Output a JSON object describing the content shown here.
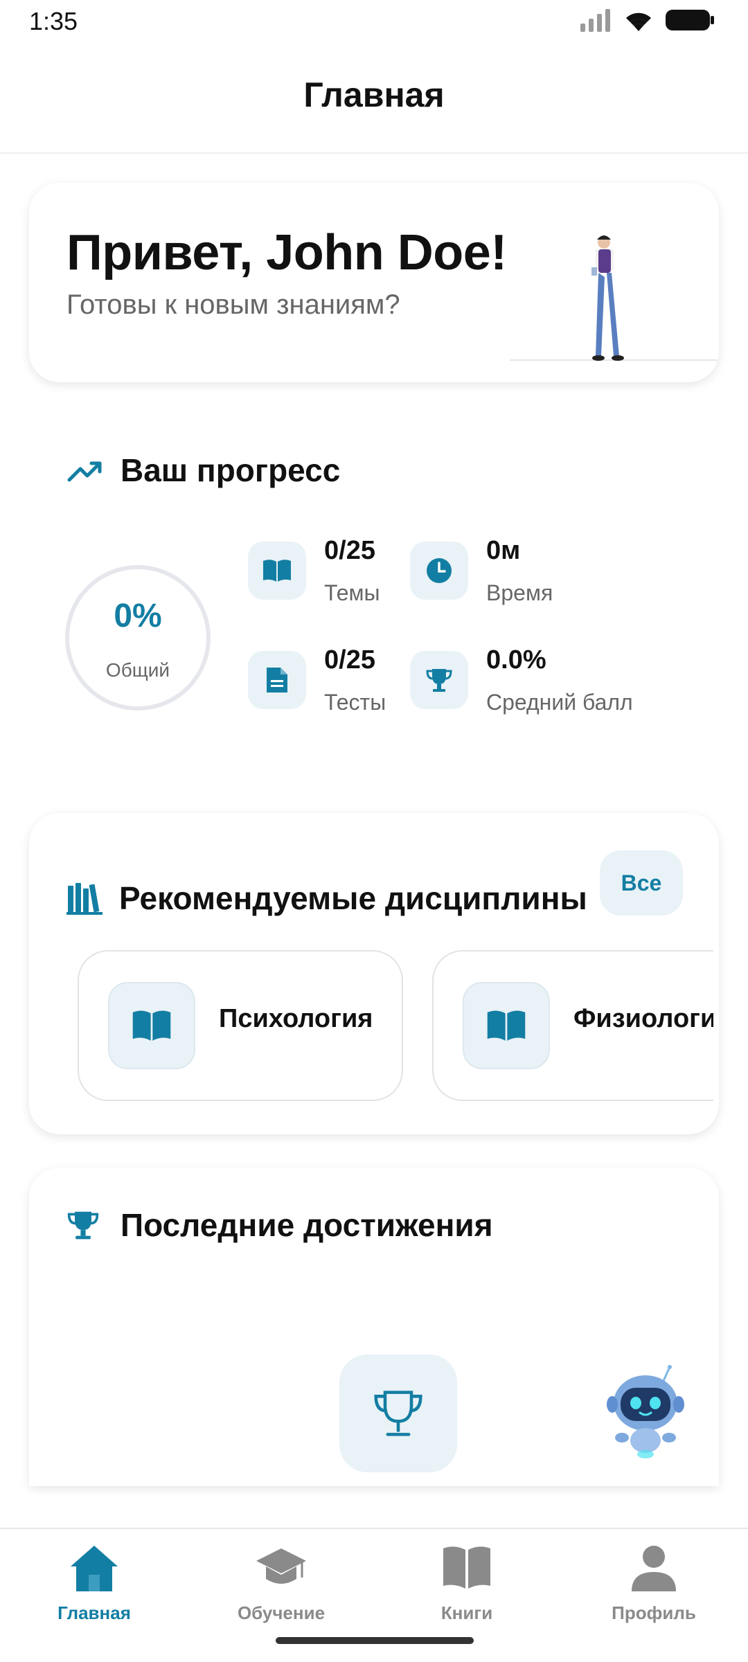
{
  "status_bar": {
    "time": "1:35",
    "icons": [
      "signal-icon",
      "wifi-icon",
      "battery-icon"
    ]
  },
  "header": {
    "title": "Главная"
  },
  "greeting": {
    "title": "Привет, John Doe!",
    "subtitle": "Готовы к новым знаниям?"
  },
  "progress": {
    "title": "Ваш прогресс",
    "overall_percent": "0%",
    "overall_label": "Общий",
    "stats": [
      {
        "icon": "book-open-icon",
        "value": "0/25",
        "label": "Темы"
      },
      {
        "icon": "clock-icon",
        "value": "0м",
        "label": "Время"
      },
      {
        "icon": "document-icon",
        "value": "0/25",
        "label": "Тесты"
      },
      {
        "icon": "trophy-icon",
        "value": "0.0%",
        "label": "Средний балл"
      }
    ]
  },
  "recommended": {
    "title": "Рекомендуемые дисциплины",
    "all_label": "Все",
    "items": [
      {
        "icon": "book-open-icon",
        "name": "Психология"
      },
      {
        "icon": "book-open-icon",
        "name": "Физиология"
      }
    ]
  },
  "achievements": {
    "title": "Последние достижения"
  },
  "nav": {
    "items": [
      {
        "icon": "home-icon",
        "label": "Главная",
        "active": true
      },
      {
        "icon": "graduation-cap-icon",
        "label": "Обучение",
        "active": false
      },
      {
        "icon": "book-icon",
        "label": "Книги",
        "active": false
      },
      {
        "icon": "person-icon",
        "label": "Профиль",
        "active": false
      }
    ]
  },
  "colors": {
    "accent": "#137ea3",
    "tile_bg": "#e9f2f7",
    "muted": "#8a8a8a"
  }
}
